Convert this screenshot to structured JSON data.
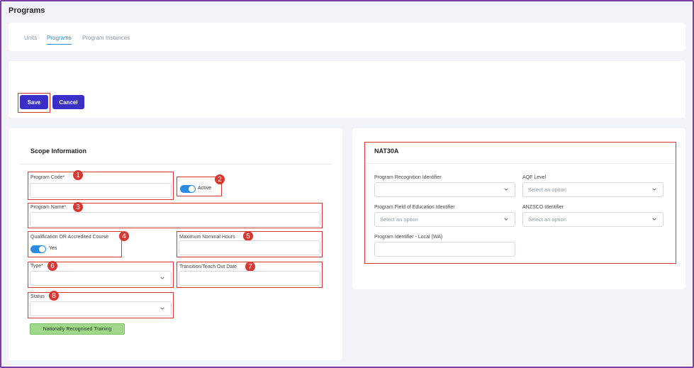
{
  "page": {
    "title": "Programs"
  },
  "tabs": [
    {
      "label": "Units"
    },
    {
      "label": "Programs"
    },
    {
      "label": "Program Instances"
    }
  ],
  "actions": {
    "save_label": "Save",
    "cancel_label": "Cancel"
  },
  "scope": {
    "title": "Scope Information",
    "program_code_label": "Program Code*",
    "active_label": "Active",
    "program_name_label": "Program Name*",
    "qualification_label": "Qualification OR Accredited Course",
    "qualification_value": "Yes",
    "max_hours_label": "Maximum Nominal Hours",
    "type_label": "Type*",
    "transition_label": "Transition/Teach Out Date",
    "status_label": "Status",
    "tag_label": "Nationally Recognised Training"
  },
  "nat": {
    "title": "NAT30A",
    "recognition_label": "Program Recognition Identifier",
    "aqf_label": "AQF Level",
    "aqf_placeholder": "Select an option",
    "foe_label": "Program Field of Education Identifier",
    "foe_placeholder": "Select an option",
    "anzsco_label": "ANZSCO Identifier",
    "anzsco_placeholder": "Select an option",
    "local_label": "Program Identifier - Local (WA)"
  },
  "callouts": [
    "1",
    "2",
    "3",
    "4",
    "5",
    "6",
    "7",
    "8"
  ],
  "colors": {
    "primary": "#3b2fc9",
    "highlight": "#d9372f",
    "toggle": "#2b8be0",
    "tab_active": "#2f8fd0",
    "tag_bg": "#9fd88a"
  }
}
